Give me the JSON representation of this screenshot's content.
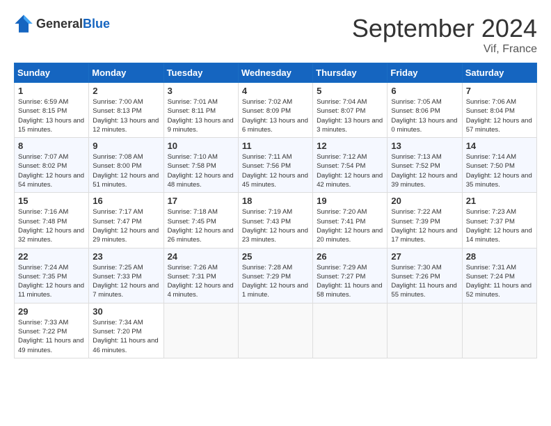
{
  "header": {
    "logo_general": "General",
    "logo_blue": "Blue",
    "month_title": "September 2024",
    "location": "Vif, France"
  },
  "weekdays": [
    "Sunday",
    "Monday",
    "Tuesday",
    "Wednesday",
    "Thursday",
    "Friday",
    "Saturday"
  ],
  "weeks": [
    [
      {
        "day": "1",
        "sunrise": "Sunrise: 6:59 AM",
        "sunset": "Sunset: 8:15 PM",
        "daylight": "Daylight: 13 hours and 15 minutes."
      },
      {
        "day": "2",
        "sunrise": "Sunrise: 7:00 AM",
        "sunset": "Sunset: 8:13 PM",
        "daylight": "Daylight: 13 hours and 12 minutes."
      },
      {
        "day": "3",
        "sunrise": "Sunrise: 7:01 AM",
        "sunset": "Sunset: 8:11 PM",
        "daylight": "Daylight: 13 hours and 9 minutes."
      },
      {
        "day": "4",
        "sunrise": "Sunrise: 7:02 AM",
        "sunset": "Sunset: 8:09 PM",
        "daylight": "Daylight: 13 hours and 6 minutes."
      },
      {
        "day": "5",
        "sunrise": "Sunrise: 7:04 AM",
        "sunset": "Sunset: 8:07 PM",
        "daylight": "Daylight: 13 hours and 3 minutes."
      },
      {
        "day": "6",
        "sunrise": "Sunrise: 7:05 AM",
        "sunset": "Sunset: 8:06 PM",
        "daylight": "Daylight: 13 hours and 0 minutes."
      },
      {
        "day": "7",
        "sunrise": "Sunrise: 7:06 AM",
        "sunset": "Sunset: 8:04 PM",
        "daylight": "Daylight: 12 hours and 57 minutes."
      }
    ],
    [
      {
        "day": "8",
        "sunrise": "Sunrise: 7:07 AM",
        "sunset": "Sunset: 8:02 PM",
        "daylight": "Daylight: 12 hours and 54 minutes."
      },
      {
        "day": "9",
        "sunrise": "Sunrise: 7:08 AM",
        "sunset": "Sunset: 8:00 PM",
        "daylight": "Daylight: 12 hours and 51 minutes."
      },
      {
        "day": "10",
        "sunrise": "Sunrise: 7:10 AM",
        "sunset": "Sunset: 7:58 PM",
        "daylight": "Daylight: 12 hours and 48 minutes."
      },
      {
        "day": "11",
        "sunrise": "Sunrise: 7:11 AM",
        "sunset": "Sunset: 7:56 PM",
        "daylight": "Daylight: 12 hours and 45 minutes."
      },
      {
        "day": "12",
        "sunrise": "Sunrise: 7:12 AM",
        "sunset": "Sunset: 7:54 PM",
        "daylight": "Daylight: 12 hours and 42 minutes."
      },
      {
        "day": "13",
        "sunrise": "Sunrise: 7:13 AM",
        "sunset": "Sunset: 7:52 PM",
        "daylight": "Daylight: 12 hours and 39 minutes."
      },
      {
        "day": "14",
        "sunrise": "Sunrise: 7:14 AM",
        "sunset": "Sunset: 7:50 PM",
        "daylight": "Daylight: 12 hours and 35 minutes."
      }
    ],
    [
      {
        "day": "15",
        "sunrise": "Sunrise: 7:16 AM",
        "sunset": "Sunset: 7:48 PM",
        "daylight": "Daylight: 12 hours and 32 minutes."
      },
      {
        "day": "16",
        "sunrise": "Sunrise: 7:17 AM",
        "sunset": "Sunset: 7:47 PM",
        "daylight": "Daylight: 12 hours and 29 minutes."
      },
      {
        "day": "17",
        "sunrise": "Sunrise: 7:18 AM",
        "sunset": "Sunset: 7:45 PM",
        "daylight": "Daylight: 12 hours and 26 minutes."
      },
      {
        "day": "18",
        "sunrise": "Sunrise: 7:19 AM",
        "sunset": "Sunset: 7:43 PM",
        "daylight": "Daylight: 12 hours and 23 minutes."
      },
      {
        "day": "19",
        "sunrise": "Sunrise: 7:20 AM",
        "sunset": "Sunset: 7:41 PM",
        "daylight": "Daylight: 12 hours and 20 minutes."
      },
      {
        "day": "20",
        "sunrise": "Sunrise: 7:22 AM",
        "sunset": "Sunset: 7:39 PM",
        "daylight": "Daylight: 12 hours and 17 minutes."
      },
      {
        "day": "21",
        "sunrise": "Sunrise: 7:23 AM",
        "sunset": "Sunset: 7:37 PM",
        "daylight": "Daylight: 12 hours and 14 minutes."
      }
    ],
    [
      {
        "day": "22",
        "sunrise": "Sunrise: 7:24 AM",
        "sunset": "Sunset: 7:35 PM",
        "daylight": "Daylight: 12 hours and 11 minutes."
      },
      {
        "day": "23",
        "sunrise": "Sunrise: 7:25 AM",
        "sunset": "Sunset: 7:33 PM",
        "daylight": "Daylight: 12 hours and 7 minutes."
      },
      {
        "day": "24",
        "sunrise": "Sunrise: 7:26 AM",
        "sunset": "Sunset: 7:31 PM",
        "daylight": "Daylight: 12 hours and 4 minutes."
      },
      {
        "day": "25",
        "sunrise": "Sunrise: 7:28 AM",
        "sunset": "Sunset: 7:29 PM",
        "daylight": "Daylight: 12 hours and 1 minute."
      },
      {
        "day": "26",
        "sunrise": "Sunrise: 7:29 AM",
        "sunset": "Sunset: 7:27 PM",
        "daylight": "Daylight: 11 hours and 58 minutes."
      },
      {
        "day": "27",
        "sunrise": "Sunrise: 7:30 AM",
        "sunset": "Sunset: 7:26 PM",
        "daylight": "Daylight: 11 hours and 55 minutes."
      },
      {
        "day": "28",
        "sunrise": "Sunrise: 7:31 AM",
        "sunset": "Sunset: 7:24 PM",
        "daylight": "Daylight: 11 hours and 52 minutes."
      }
    ],
    [
      {
        "day": "29",
        "sunrise": "Sunrise: 7:33 AM",
        "sunset": "Sunset: 7:22 PM",
        "daylight": "Daylight: 11 hours and 49 minutes."
      },
      {
        "day": "30",
        "sunrise": "Sunrise: 7:34 AM",
        "sunset": "Sunset: 7:20 PM",
        "daylight": "Daylight: 11 hours and 46 minutes."
      },
      null,
      null,
      null,
      null,
      null
    ]
  ]
}
